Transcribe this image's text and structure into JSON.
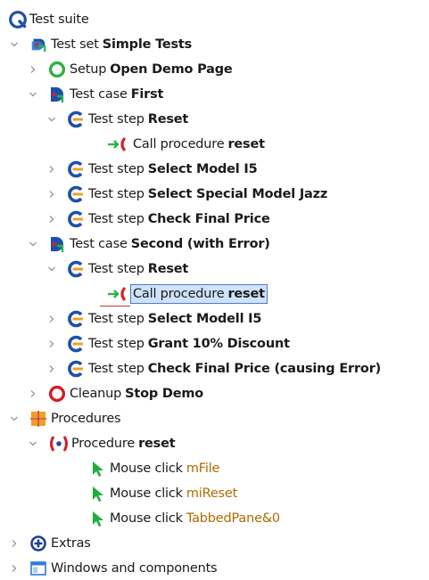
{
  "tree": {
    "nodes": [
      {
        "type": "Test suite",
        "name": "",
        "icon": "test-suite-icon"
      },
      {
        "type": "Test set",
        "name": "Simple Tests",
        "icon": "test-set-icon"
      },
      {
        "type": "Setup",
        "name": "Open Demo Page",
        "icon": "setup-icon"
      },
      {
        "type": "Test case",
        "name": "First",
        "icon": "test-case-icon"
      },
      {
        "type": "Test step",
        "name": "Reset",
        "icon": "test-step-icon"
      },
      {
        "type": "Call procedure",
        "name": "reset",
        "icon": "call-procedure-icon"
      },
      {
        "type": "Test step",
        "name": "Select Model I5",
        "icon": "test-step-icon"
      },
      {
        "type": "Test step",
        "name": "Select Special Model Jazz",
        "icon": "test-step-icon"
      },
      {
        "type": "Test step",
        "name": "Check Final Price",
        "icon": "test-step-icon"
      },
      {
        "type": "Test case",
        "name": "Second (with Error)",
        "icon": "test-case-icon"
      },
      {
        "type": "Test step",
        "name": "Reset",
        "icon": "test-step-icon"
      },
      {
        "type": "Call procedure",
        "name": "reset",
        "icon": "call-procedure-icon",
        "selected": true
      },
      {
        "type": "Test step",
        "name": "Select Modell I5",
        "icon": "test-step-icon"
      },
      {
        "type": "Test step",
        "name": "Grant 10% Discount",
        "icon": "test-step-icon"
      },
      {
        "type": "Test step",
        "name": "Check Final Price (causing Error)",
        "icon": "test-step-icon"
      },
      {
        "type": "Cleanup",
        "name": "Stop Demo",
        "icon": "cleanup-icon"
      },
      {
        "type": "Procedures",
        "name": "",
        "icon": "procedures-icon"
      },
      {
        "type": "Procedure",
        "name": "reset",
        "icon": "procedure-icon"
      },
      {
        "type": "Mouse click",
        "name": "mFile",
        "icon": "mouse-click-icon",
        "component": true
      },
      {
        "type": "Mouse click",
        "name": "miReset",
        "icon": "mouse-click-icon",
        "component": true
      },
      {
        "type": "Mouse click",
        "name": "TabbedPane&0",
        "icon": "mouse-click-icon",
        "component": true
      },
      {
        "type": "Extras",
        "name": "",
        "icon": "extras-icon"
      },
      {
        "type": "Windows and components",
        "name": "",
        "icon": "windows-components-icon"
      }
    ]
  },
  "colors": {
    "selection_fill": "#cfe2fb",
    "selection_border": "#4a7bc8",
    "component_name": "#b06a00",
    "chevron": "#8a8a8a"
  }
}
